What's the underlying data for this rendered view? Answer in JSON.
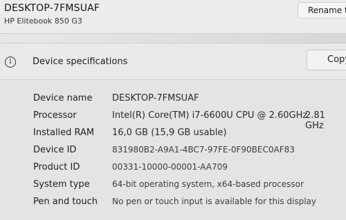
{
  "device": {
    "name": "DESKTOP-7FMSUAF",
    "model": "HP Elitebook 850 G3",
    "rename_label": "Rename t"
  },
  "specs": {
    "info_icon": "info-icon",
    "title": "Device specifications",
    "copy_label": "Copy",
    "rows": [
      {
        "label": "Device name",
        "value": "DESKTOP-7FMSUAF"
      },
      {
        "label": "Processor",
        "value": "Intel(R) Core(TM) i7-6600U CPU @ 2.60GHz",
        "extra": "2.81 GHz"
      },
      {
        "label": "Installed RAM",
        "value": "16,0 GB (15,9 GB usable)"
      },
      {
        "label": "Device ID",
        "value": "831980B2-A9A1-4BC7-97FE-0F90BEC0AF83"
      },
      {
        "label": "Product ID",
        "value": "00331-10000-00001-AA709"
      },
      {
        "label": "System type",
        "value": "64-bit operating system, x64-based processor"
      },
      {
        "label": "Pen and touch",
        "value": "No pen or touch input is available for this display"
      }
    ]
  }
}
